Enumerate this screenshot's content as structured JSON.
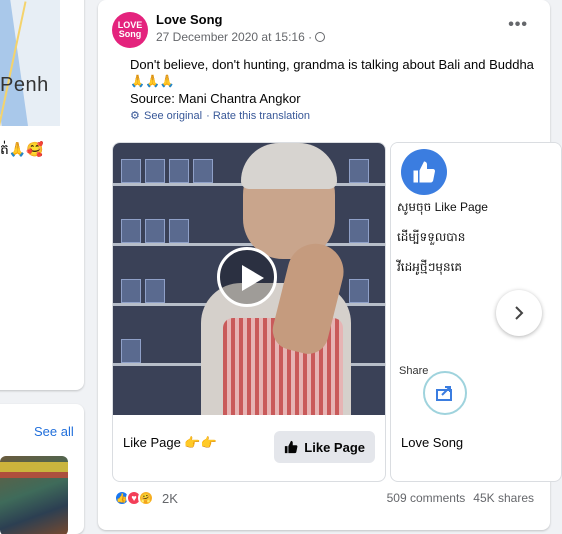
{
  "left": {
    "map_label": "Penh",
    "emoji_text": "ត់🙏🥰",
    "see_all": "See all"
  },
  "post": {
    "page_name": "Love Song",
    "avatar_text_top": "LOVE",
    "avatar_text_bottom": "Song",
    "timestamp": "27 December 2020 at 15:16 ·",
    "text_line1": "Don't believe, don't hunting, grandma is talking about Bali and Buddha",
    "text_line2": "🙏🙏🙏",
    "text_line3": "Source: Mani Chantra Angkor",
    "see_original": "See original",
    "rate_translation": "· Rate this translation",
    "more_label": "•••",
    "brand_color": "#e4237d",
    "link_color": "#385898"
  },
  "attachments": {
    "card1": {
      "label": "Like Page 👉👉",
      "button_label": "Like Page"
    },
    "card2": {
      "line1": "សូមចុច Like Page",
      "line2": "ដើម្បីទទួលបាន",
      "line3": "វីដេអូថ្មីៗមុនគេ",
      "share_label": "Share",
      "label": "Love Song"
    }
  },
  "footer": {
    "reaction_count": "2K",
    "comments": "509 comments",
    "shares": "45K shares"
  }
}
